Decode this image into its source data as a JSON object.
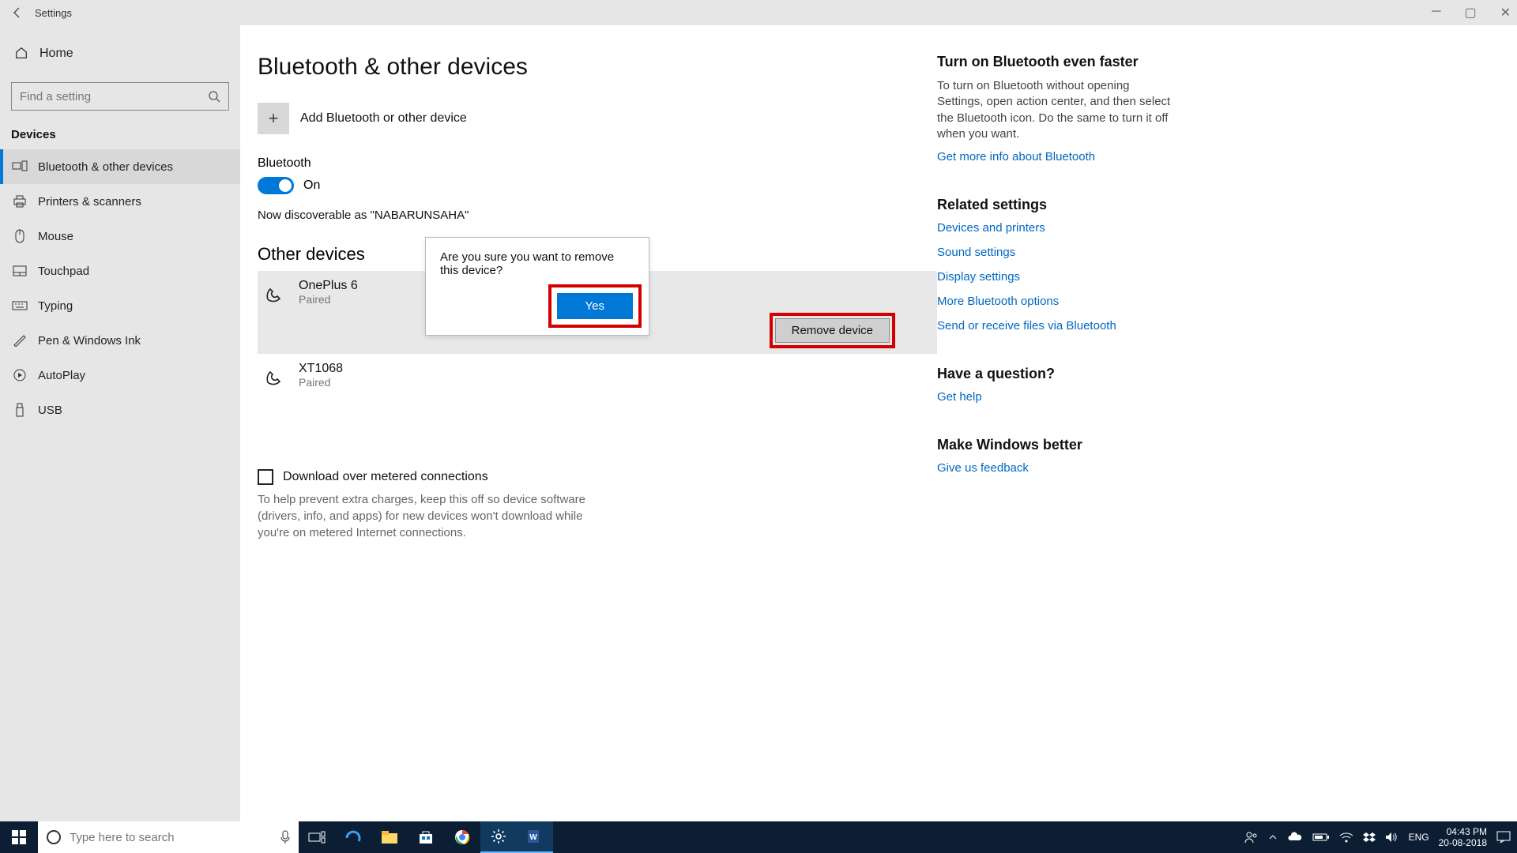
{
  "window": {
    "title": "Settings"
  },
  "sidebar": {
    "home": "Home",
    "search_placeholder": "Find a setting",
    "group": "Devices",
    "items": [
      {
        "label": "Bluetooth & other devices"
      },
      {
        "label": "Printers & scanners"
      },
      {
        "label": "Mouse"
      },
      {
        "label": "Touchpad"
      },
      {
        "label": "Typing"
      },
      {
        "label": "Pen & Windows Ink"
      },
      {
        "label": "AutoPlay"
      },
      {
        "label": "USB"
      }
    ]
  },
  "main": {
    "title": "Bluetooth & other devices",
    "add_label": "Add Bluetooth or other device",
    "bt_label": "Bluetooth",
    "bt_state": "On",
    "discoverable": "Now discoverable as \"NABARUNSAHA\"",
    "other_h": "Other devices",
    "devices": [
      {
        "name": "OnePlus 6",
        "status": "Paired"
      },
      {
        "name": "XT1068",
        "status": "Paired"
      }
    ],
    "remove_btn": "Remove device",
    "dialog": {
      "msg": "Are you sure you want to remove this device?",
      "yes": "Yes"
    },
    "metered_chk": "Download over metered connections",
    "metered_help": "To help prevent extra charges, keep this off so device software (drivers, info, and apps) for new devices won't download while you're on metered Internet connections."
  },
  "right": {
    "tip_h": "Turn on Bluetooth even faster",
    "tip_body": "To turn on Bluetooth without opening Settings, open action center, and then select the Bluetooth icon. Do the same to turn it off when you want.",
    "tip_link": "Get more info about Bluetooth",
    "rel_h": "Related settings",
    "rel_links": [
      "Devices and printers",
      "Sound settings",
      "Display settings",
      "More Bluetooth options",
      "Send or receive files via Bluetooth"
    ],
    "q_h": "Have a question?",
    "q_link": "Get help",
    "fb_h": "Make Windows better",
    "fb_link": "Give us feedback"
  },
  "taskbar": {
    "search_placeholder": "Type here to search",
    "lang": "ENG",
    "time": "04:43 PM",
    "date": "20-08-2018"
  }
}
